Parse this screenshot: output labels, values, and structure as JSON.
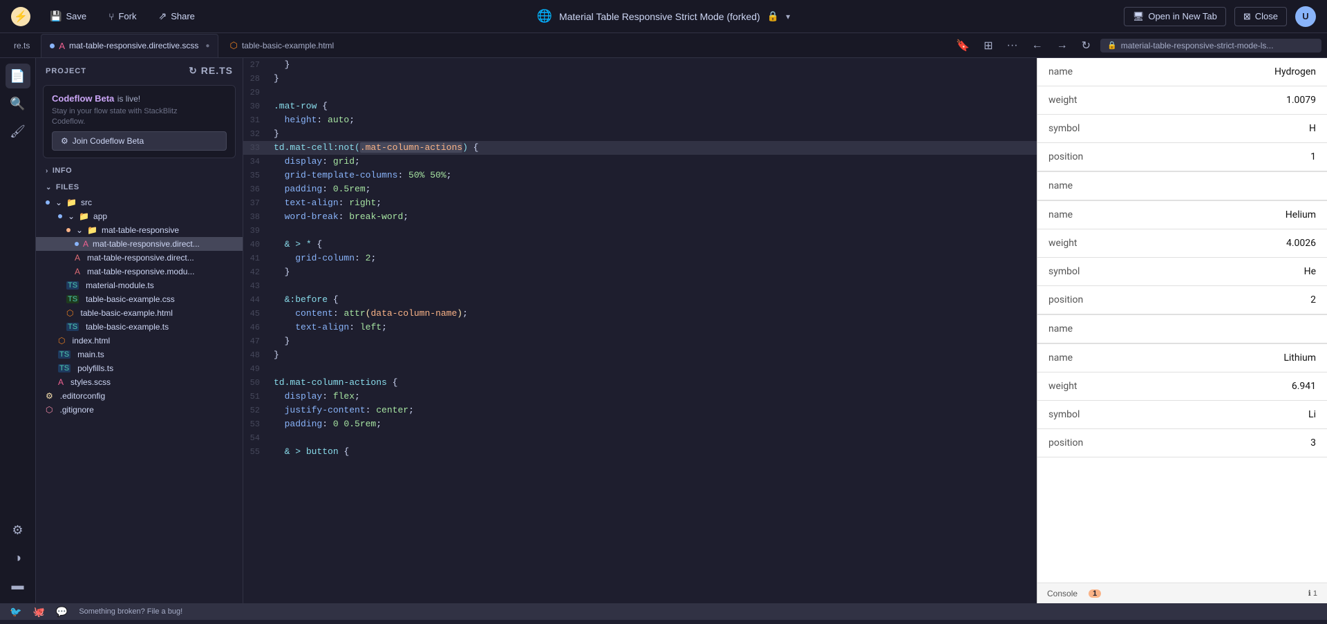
{
  "topbar": {
    "logo_symbol": "⚡",
    "save_label": "Save",
    "fork_label": "Fork",
    "share_label": "Share",
    "title": "Material Table Responsive Strict Mode (forked)",
    "lock_icon": "🔒",
    "open_in_new_tab_label": "Open in New Tab",
    "close_label": "Close",
    "avatar_text": "U"
  },
  "tabs": [
    {
      "id": "tab1",
      "label": "re.ts",
      "dot": "none",
      "active": false
    },
    {
      "id": "tab2",
      "label": "mat-table-responsive.directive.scss",
      "dot": "blue",
      "active": true
    },
    {
      "id": "tab3",
      "label": "table-basic-example.html",
      "dot": "none",
      "active": false
    }
  ],
  "address_bar": {
    "text": "material-table-responsive-strict-mode-ls..."
  },
  "nav_buttons": {
    "back": "‹",
    "forward": "›",
    "refresh": "↻"
  },
  "project_panel": {
    "header": "PROJECT",
    "codeflow": {
      "brand": "Codeflow Beta",
      "brand_suffix": " is live!",
      "line1": "Stay in your flow state with StackBlitz",
      "line2": "Codeflow.",
      "join_label": "Join Codeflow Beta"
    },
    "info_section": "INFO",
    "files_section": "FILES"
  },
  "file_tree": [
    {
      "indent": 0,
      "type": "folder",
      "label": "src",
      "dot": "blue",
      "expanded": true
    },
    {
      "indent": 1,
      "type": "folder",
      "label": "app",
      "dot": "blue",
      "expanded": true
    },
    {
      "indent": 2,
      "type": "folder",
      "label": "mat-table-responsive",
      "dot": "orange",
      "expanded": true
    },
    {
      "indent": 3,
      "type": "file-scss",
      "label": "mat-table-responsive.direct...",
      "dot": "blue",
      "active": true
    },
    {
      "indent": 3,
      "type": "file-ts-a",
      "label": "mat-table-responsive.direct...",
      "dot": "none"
    },
    {
      "indent": 3,
      "type": "file-ts-m",
      "label": "mat-table-responsive.modu...",
      "dot": "none"
    },
    {
      "indent": 2,
      "type": "file-ts",
      "label": "material-module.ts",
      "dot": "none"
    },
    {
      "indent": 2,
      "type": "file-css",
      "label": "table-basic-example.css",
      "dot": "none"
    },
    {
      "indent": 2,
      "type": "file-html",
      "label": "table-basic-example.html",
      "dot": "none"
    },
    {
      "indent": 2,
      "type": "file-ts",
      "label": "table-basic-example.ts",
      "dot": "none"
    },
    {
      "indent": 1,
      "type": "file-html",
      "label": "index.html",
      "dot": "none"
    },
    {
      "indent": 1,
      "type": "file-ts",
      "label": "main.ts",
      "dot": "none"
    },
    {
      "indent": 1,
      "type": "file-ts",
      "label": "polyfills.ts",
      "dot": "none"
    },
    {
      "indent": 1,
      "type": "file-scss",
      "label": "styles.scss",
      "dot": "none"
    },
    {
      "indent": 0,
      "type": "file-cfg",
      "label": ".editorconfig",
      "dot": "none"
    },
    {
      "indent": 0,
      "type": "file-git",
      "label": ".gitignore",
      "dot": "none"
    }
  ],
  "code_lines": [
    {
      "num": 27,
      "content": "  }"
    },
    {
      "num": 28,
      "content": "}"
    },
    {
      "num": 29,
      "content": ""
    },
    {
      "num": 30,
      "content": ".mat-row {"
    },
    {
      "num": 31,
      "content": "  height: auto;"
    },
    {
      "num": 32,
      "content": "}"
    },
    {
      "num": 33,
      "content": "td.mat-cell:not(.mat-column-actions) {",
      "highlighted": true
    },
    {
      "num": 34,
      "content": "  display: grid;"
    },
    {
      "num": 35,
      "content": "  grid-template-columns: 50% 50%;"
    },
    {
      "num": 36,
      "content": "  padding: 0.5rem;"
    },
    {
      "num": 37,
      "content": "  text-align: right;"
    },
    {
      "num": 38,
      "content": "  word-break: break-word;"
    },
    {
      "num": 39,
      "content": ""
    },
    {
      "num": 40,
      "content": "  & > * {"
    },
    {
      "num": 41,
      "content": "    grid-column: 2;"
    },
    {
      "num": 42,
      "content": "  }"
    },
    {
      "num": 43,
      "content": ""
    },
    {
      "num": 44,
      "content": "  &:before {"
    },
    {
      "num": 45,
      "content": "    content: attr(data-column-name);"
    },
    {
      "num": 46,
      "content": "    text-align: left;"
    },
    {
      "num": 47,
      "content": "  }"
    },
    {
      "num": 48,
      "content": "}"
    },
    {
      "num": 49,
      "content": ""
    },
    {
      "num": 50,
      "content": "td.mat-column-actions {"
    },
    {
      "num": 51,
      "content": "  display: flex;"
    },
    {
      "num": 52,
      "content": "  justify-content: center;"
    },
    {
      "num": 53,
      "content": "  padding: 0 0.5rem;"
    },
    {
      "num": 54,
      "content": ""
    },
    {
      "num": 55,
      "content": "  & > button {"
    }
  ],
  "preview": {
    "sections": [
      {
        "rows": [
          {
            "label": "name",
            "value": "Hydrogen"
          },
          {
            "label": "weight",
            "value": "1.0079"
          },
          {
            "label": "symbol",
            "value": "H"
          },
          {
            "label": "position",
            "value": "1"
          }
        ]
      },
      {
        "rows": [
          {
            "label": "name",
            "value": ""
          }
        ]
      },
      {
        "rows": [
          {
            "label": "name",
            "value": "Helium"
          },
          {
            "label": "weight",
            "value": "4.0026"
          },
          {
            "label": "symbol",
            "value": "He"
          },
          {
            "label": "position",
            "value": "2"
          }
        ]
      },
      {
        "rows": [
          {
            "label": "name",
            "value": ""
          }
        ]
      },
      {
        "rows": [
          {
            "label": "name",
            "value": "Lithium"
          },
          {
            "label": "weight",
            "value": "6.941"
          },
          {
            "label": "symbol",
            "value": "Li"
          },
          {
            "label": "position",
            "value": "3"
          }
        ]
      }
    ]
  },
  "console": {
    "label": "Console",
    "badge": "1"
  },
  "statusbar": {
    "broken_text": "Something broken? File a bug!"
  },
  "icons": {
    "lightning": "⚡",
    "save": "💾",
    "fork": "⑂",
    "share": "⇗",
    "globe": "🌐",
    "lock": "🔒",
    "monitor": "🖥",
    "close_square": "⊠",
    "files": "📄",
    "search": "🔍",
    "brush": "🖌",
    "settings": "⚙",
    "half_circle": "◑",
    "panel_bottom": "▬",
    "chevron_right": "›",
    "chevron_down": "⌄",
    "refresh": "↻",
    "back": "←",
    "forward": "→",
    "dots": "···",
    "shield": "🛡",
    "twitter": "🐦",
    "github": "ⓖ",
    "discord": "🎮"
  }
}
